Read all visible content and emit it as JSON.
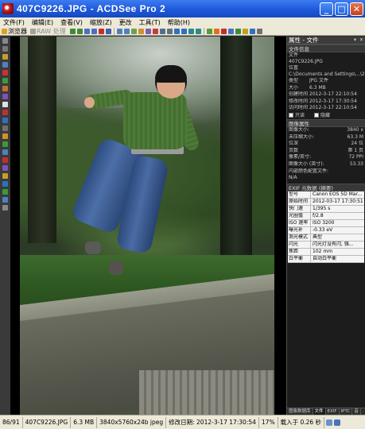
{
  "window": {
    "title": "407C9226.JPG - ACDSee Pro 2"
  },
  "menu": [
    "文件(F)",
    "编辑(E)",
    "查看(V)",
    "缩放(Z)",
    "更改",
    "工具(T)",
    "帮助(H)"
  ],
  "toolbar": {
    "browser_label": "浏览器",
    "raw_label": "RAW 处理"
  },
  "panel": {
    "title": "属性 - 文件",
    "file_info": {
      "heading": "文件信息",
      "file_label": "文件",
      "file_value": "407C9226.JPG",
      "location_label": "位置",
      "location_value": "C:\\Documents and Settings\\...\\2",
      "rows": [
        {
          "k": "类型",
          "v": "JPG 文件"
        },
        {
          "k": "大小",
          "v": "6.3 MB"
        },
        {
          "k": "创建时间",
          "v": "2012-3-17 22:10:54"
        },
        {
          "k": "修改时间",
          "v": "2012-3-17 17:30:54"
        },
        {
          "k": "访问时间",
          "v": "2012-3-17 22:10:54"
        }
      ],
      "readonly_label": "只读",
      "hidden_label": "隐藏"
    },
    "image_attrs": {
      "heading": "图像属性",
      "rows": [
        {
          "k": "图像大小:",
          "v": "3840 x"
        },
        {
          "k": "未压缩大小:",
          "v": "63.3 M"
        },
        {
          "k": "位深",
          "v": "24 位"
        },
        {
          "k": "页数",
          "v": "第 1 页"
        },
        {
          "k": "像素/英寸:",
          "v": "72 PPI"
        },
        {
          "k": "图像大小 (英寸):",
          "v": "53.33"
        }
      ],
      "embedded_label": "内嵌颜色配置文件:",
      "embedded_value": "N/A"
    },
    "exif": {
      "heading": "EXIF 元数据 (摘要)",
      "rows": [
        {
          "k": "型号",
          "v": "Canon EOS 5D Mar..."
        },
        {
          "k": "原始时间",
          "v": "2012-03-17 17:30:51"
        },
        {
          "k": "快门速",
          "v": "1/395 s"
        },
        {
          "k": "光圈值",
          "v": "f/2.8"
        },
        {
          "k": "ISO 速率",
          "v": "ISO 3200"
        },
        {
          "k": "曝光补",
          "v": "-0.33 eV"
        },
        {
          "k": "测光模式",
          "v": "典型"
        },
        {
          "k": "闪光",
          "v": "闪光灯没有闪, 强..."
        },
        {
          "k": "焦距",
          "v": "102 mm"
        },
        {
          "k": "白平衡",
          "v": "自动白平衡"
        }
      ]
    },
    "tabs": [
      "图像数据库",
      "文件",
      "EXIF",
      "IPTC",
      "音"
    ]
  },
  "status": {
    "index": "86/91",
    "filename": "407C9226.JPG",
    "size": "6.3 MB",
    "dimensions": "3840x5760x24b jpeg",
    "modified": "修改日期: 2012-3-17 17:30:54",
    "zoom": "17%",
    "load": "载入于 0.26 秒"
  },
  "colors": {
    "title_bar": "#1c56d8",
    "menu_bg": "#ece9d8",
    "panel_bg": "#1c1c1c"
  }
}
